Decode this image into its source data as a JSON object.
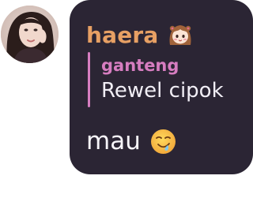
{
  "message": {
    "sender": "haera",
    "sender_badge_icon": "chibi-girl-icon",
    "reply": {
      "author": "ganteng",
      "text": "Rewel cipok"
    },
    "text": "mau",
    "emoji_icon": "drooling-face-icon"
  },
  "colors": {
    "bubble_background": "#2b2534",
    "sender_name": "#e7a064",
    "reply_accent": "#d67dc0",
    "message_text": "#f7f5fa"
  }
}
